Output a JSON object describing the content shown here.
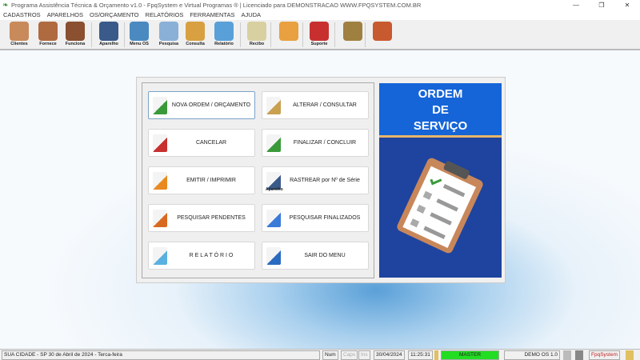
{
  "window": {
    "title": "Programa Assistência Técnica & Orçamento v1.0 - FpqSystem e Virtual Programas ® | Licenciado para  DEMONSTRACAO WWW.FPQSYSTEM.COM.BR",
    "minimize": "—",
    "maximize": "❐",
    "close": "✕"
  },
  "menu": [
    "CADASTROS",
    "APARELHOS",
    "OS/ORÇAMENTO",
    "RELATÓRIOS",
    "FERRAMENTAS",
    "AJUDA"
  ],
  "toolbar": [
    {
      "label": "Clientes",
      "color": "#c88a5a"
    },
    {
      "label": "Fornece",
      "color": "#b06a40"
    },
    {
      "label": "Funciona",
      "color": "#8a5030"
    },
    {
      "label": "Aparelho",
      "color": "#3a5a8a"
    },
    {
      "label": "Menu OS",
      "color": "#4a8ac0"
    },
    {
      "label": "Pesquisa",
      "color": "#8ab0d8"
    },
    {
      "label": "Consulta",
      "color": "#d8a040"
    },
    {
      "label": "Relatório",
      "color": "#5aa0d8"
    },
    {
      "label": "Recibo",
      "color": "#d8d0a0"
    },
    {
      "label": "",
      "color": "#e8a040"
    },
    {
      "label": "Suporte",
      "color": "#c83030"
    },
    {
      "label": "",
      "color": "#a08040"
    },
    {
      "label": "",
      "color": "#c85a30"
    }
  ],
  "buttons": [
    {
      "label": "NOVA ORDEM / ORÇAMENTO",
      "icon": "new-document-icon",
      "color": "#3a9a3a"
    },
    {
      "label": "ALTERAR  /  CONSULTAR",
      "icon": "pencil-icon",
      "color": "#c8a050"
    },
    {
      "label": "CANCELAR",
      "icon": "cancel-document-icon",
      "color": "#c83030"
    },
    {
      "label": "FINALIZAR  /  CONCLUIR",
      "icon": "check-document-icon",
      "color": "#3a9a3a"
    },
    {
      "label": "EMITIR  /  IMPRIMIR",
      "icon": "print-person-icon",
      "color": "#e88a20"
    },
    {
      "label": "RASTREAR por Nº de Série",
      "icon": "device-icon",
      "color": "#3a5a8a",
      "sub": "Aparelho"
    },
    {
      "label": "PESQUISAR PENDENTES",
      "icon": "search-chart-icon",
      "color": "#d86a20"
    },
    {
      "label": "PESQUISAR FINALIZADOS",
      "icon": "search-chart-icon",
      "color": "#3a7ad8"
    },
    {
      "label": "R E L A T Ó R I O",
      "icon": "printer-icon",
      "color": "#5ab0e0"
    },
    {
      "label": "SAIR DO MENU",
      "icon": "exit-icon",
      "color": "#2a6ac0"
    }
  ],
  "banner": {
    "line1": "ORDEM",
    "line2": "DE",
    "line3": "SERVIÇO"
  },
  "status": {
    "city": "SUA CIDADE - SP 30 de Abril de 2024 - Terca-feira",
    "num": "Num",
    "caps": "Caps",
    "ins": "Ins",
    "date": "30/04/2024",
    "time": "11:25:31",
    "user": "MASTER",
    "db": "DEMO OS 1.0",
    "brand": "FpqSystem",
    "user_color": "#22dd22"
  }
}
